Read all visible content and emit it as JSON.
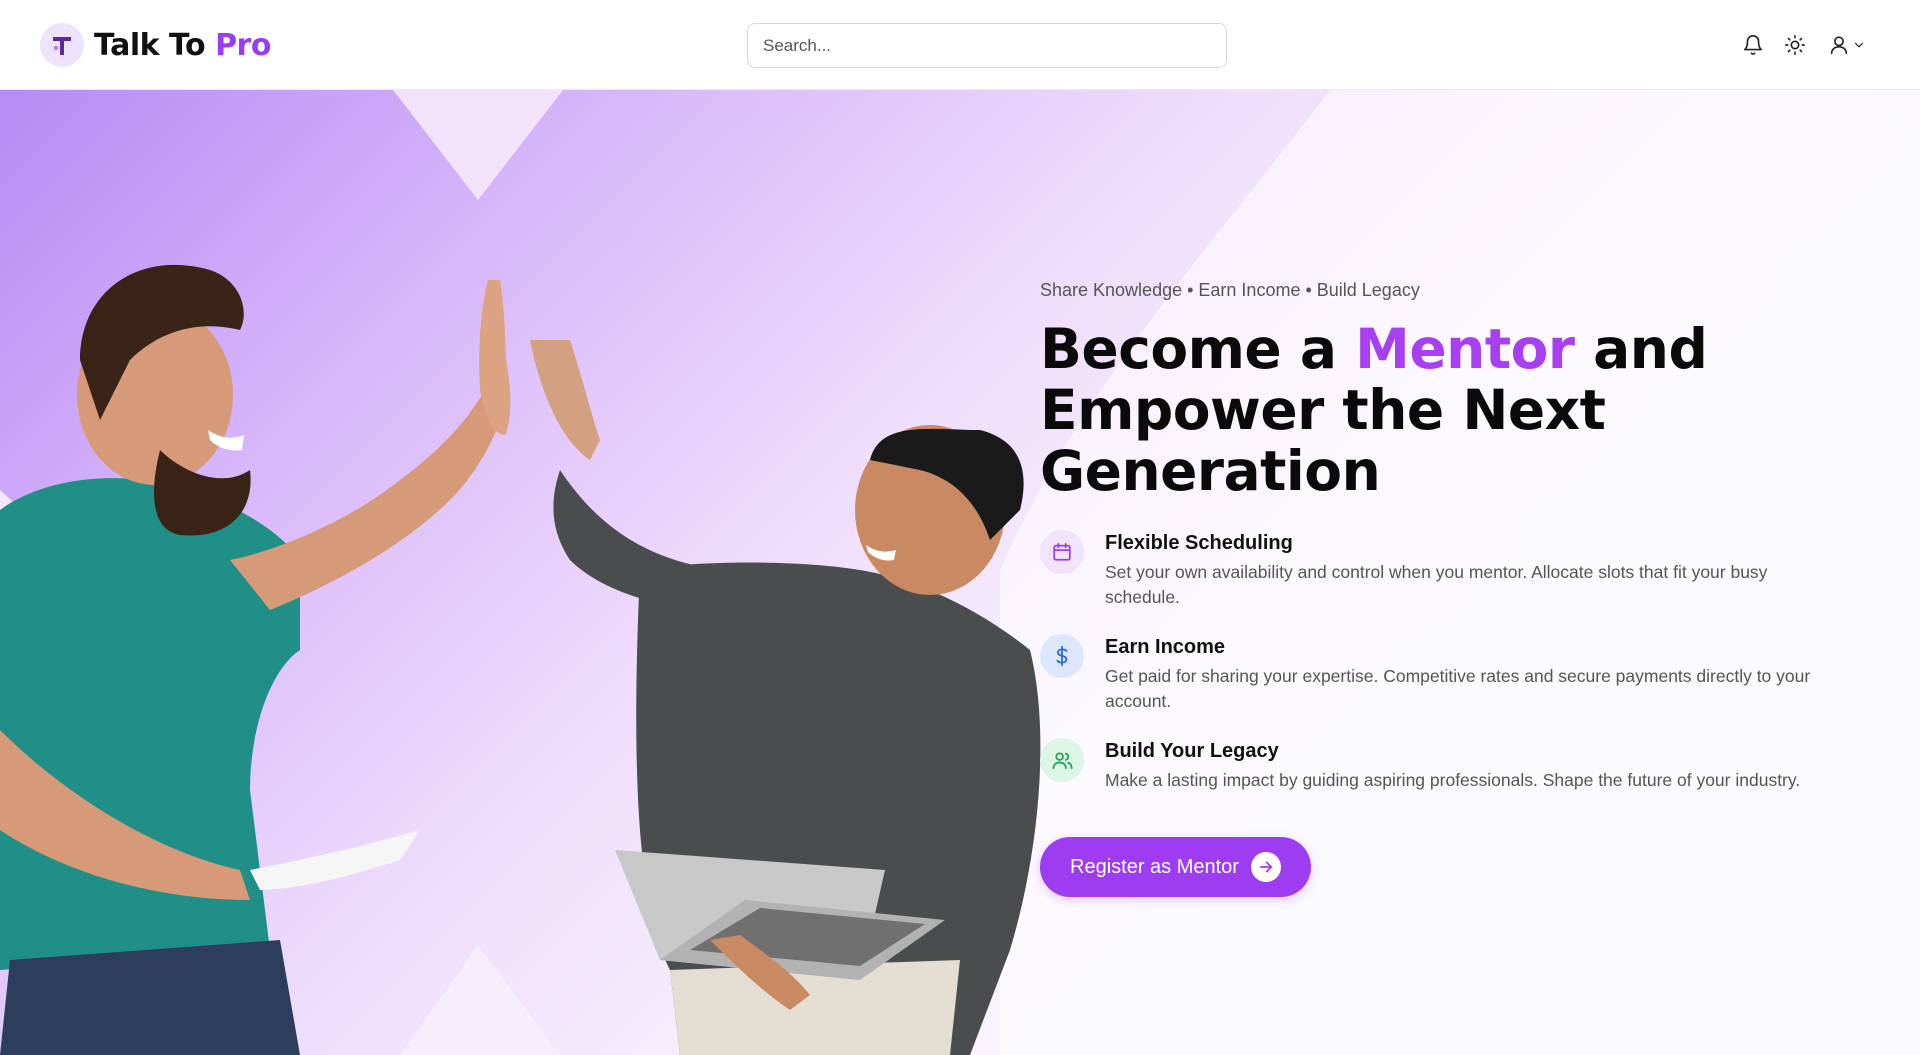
{
  "header": {
    "brand_main": "Talk To",
    "brand_accent": "Pro",
    "search_placeholder": "Search..."
  },
  "icons": {
    "logo": "logo-t-icon",
    "notifications": "bell-icon",
    "theme": "sun-icon",
    "account": "user-icon",
    "account_menu": "chevron-down-icon"
  },
  "hero": {
    "tagline": "Share Knowledge • Earn Income • Build Legacy",
    "headline_before": "Become a ",
    "headline_accent": "Mentor",
    "headline_line1_after": " and",
    "headline_line2": "Empower the Next",
    "headline_line3": "Generation",
    "features": [
      {
        "icon": "calendar-icon",
        "title": "Flexible Scheduling",
        "description": "Set your own availability and control when you mentor. Allocate slots that fit your busy schedule."
      },
      {
        "icon": "dollar-icon",
        "title": "Earn Income",
        "description": "Get paid for sharing your expertise. Competitive rates and secure payments directly to your account."
      },
      {
        "icon": "users-icon",
        "title": "Build Your Legacy",
        "description": "Make a lasting impact by guiding aspiring professionals. Shape the future of your industry."
      }
    ],
    "cta_label": "Register as Mentor",
    "cta_icon": "arrow-right-icon"
  },
  "colors": {
    "accent": "#9d3cf0",
    "headline_accent": "#a83ff1",
    "calendar_bg": "#f1e3fc",
    "dollar_bg": "#dde7fb",
    "users_bg": "#dcf5e4"
  }
}
